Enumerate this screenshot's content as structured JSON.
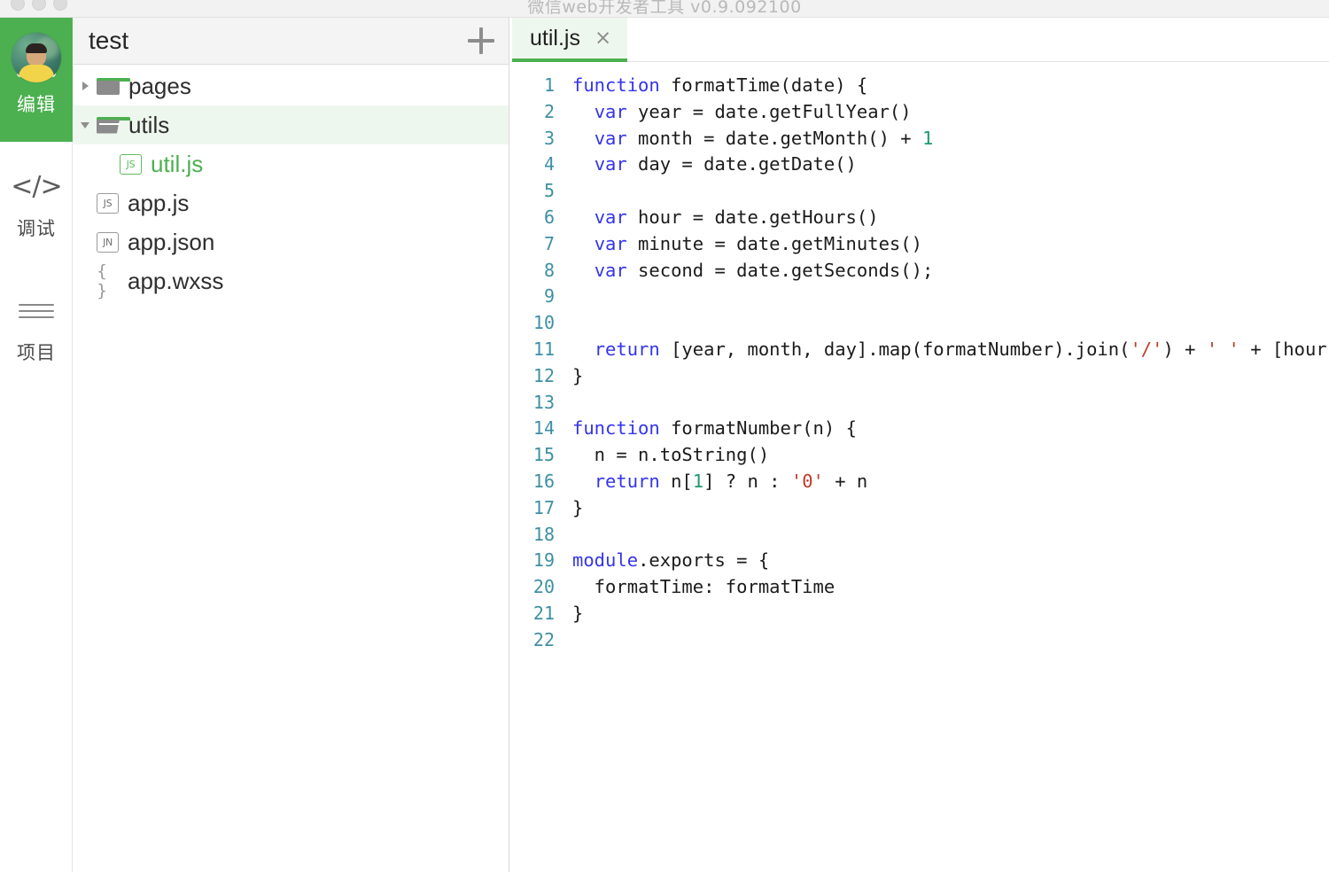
{
  "window": {
    "title": "微信web开发者工具 v0.9.092100",
    "traffic_lights": [
      "close",
      "minimize",
      "zoom"
    ]
  },
  "rail": {
    "avatar_label": "user-avatar",
    "items": [
      {
        "label": "编辑",
        "icon": "code-box-icon",
        "active": true,
        "name": "edit"
      },
      {
        "label": "调试",
        "icon": "code-brackets-icon",
        "active": false,
        "name": "debug"
      },
      {
        "label": "项目",
        "icon": "hamburger-icon",
        "active": false,
        "name": "project"
      }
    ]
  },
  "file_panel": {
    "title": "test",
    "add_button_label": "+",
    "tree": [
      {
        "label": "pages",
        "type": "folder",
        "state": "collapsed",
        "depth": 0,
        "selected": false,
        "icon": "folder-closed-icon"
      },
      {
        "label": "utils",
        "type": "folder",
        "state": "expanded",
        "depth": 0,
        "selected": true,
        "icon": "folder-open-icon"
      },
      {
        "label": "util.js",
        "type": "file",
        "badge": "JS",
        "depth": 1,
        "active": true,
        "icon": "js-file-icon"
      },
      {
        "label": "app.js",
        "type": "file",
        "badge": "JS",
        "depth": 0,
        "active": false,
        "icon": "js-file-icon"
      },
      {
        "label": "app.json",
        "type": "file",
        "badge": "JN",
        "depth": 0,
        "active": false,
        "icon": "json-file-icon"
      },
      {
        "label": "app.wxss",
        "type": "file",
        "badge": "{ }",
        "depth": 0,
        "active": false,
        "icon": "wxss-file-icon"
      }
    ]
  },
  "editor": {
    "tabs": [
      {
        "label": "util.js",
        "close": "×",
        "active": true
      }
    ],
    "total_lines": 22,
    "lines": [
      {
        "n": 1,
        "tokens": [
          {
            "t": "function",
            "c": "kw"
          },
          {
            "t": " formatTime(date) {",
            "c": ""
          }
        ]
      },
      {
        "n": 2,
        "tokens": [
          {
            "t": "  ",
            "c": ""
          },
          {
            "t": "var",
            "c": "kw"
          },
          {
            "t": " year = date.getFullYear()",
            "c": ""
          }
        ]
      },
      {
        "n": 3,
        "tokens": [
          {
            "t": "  ",
            "c": ""
          },
          {
            "t": "var",
            "c": "kw"
          },
          {
            "t": " month = date.getMonth() + ",
            "c": ""
          },
          {
            "t": "1",
            "c": "num"
          }
        ]
      },
      {
        "n": 4,
        "tokens": [
          {
            "t": "  ",
            "c": ""
          },
          {
            "t": "var",
            "c": "kw"
          },
          {
            "t": " day = date.getDate()",
            "c": ""
          }
        ]
      },
      {
        "n": 5,
        "tokens": []
      },
      {
        "n": 6,
        "tokens": [
          {
            "t": "  ",
            "c": ""
          },
          {
            "t": "var",
            "c": "kw"
          },
          {
            "t": " hour = date.getHours()",
            "c": ""
          }
        ]
      },
      {
        "n": 7,
        "tokens": [
          {
            "t": "  ",
            "c": ""
          },
          {
            "t": "var",
            "c": "kw"
          },
          {
            "t": " minute = date.getMinutes()",
            "c": ""
          }
        ]
      },
      {
        "n": 8,
        "tokens": [
          {
            "t": "  ",
            "c": ""
          },
          {
            "t": "var",
            "c": "kw"
          },
          {
            "t": " second = date.getSeconds();",
            "c": ""
          }
        ]
      },
      {
        "n": 9,
        "tokens": []
      },
      {
        "n": 10,
        "tokens": []
      },
      {
        "n": 11,
        "tokens": [
          {
            "t": "  ",
            "c": ""
          },
          {
            "t": "return",
            "c": "kw"
          },
          {
            "t": " [year, month, day].map(formatNumber).join(",
            "c": ""
          },
          {
            "t": "'/'",
            "c": "str"
          },
          {
            "t": ") + ",
            "c": ""
          },
          {
            "t": "' '",
            "c": "str"
          },
          {
            "t": " + [hour,",
            "c": ""
          }
        ]
      },
      {
        "n": 12,
        "tokens": [
          {
            "t": "}",
            "c": ""
          }
        ]
      },
      {
        "n": 13,
        "tokens": []
      },
      {
        "n": 14,
        "tokens": [
          {
            "t": "function",
            "c": "kw"
          },
          {
            "t": " formatNumber(n) {",
            "c": ""
          }
        ]
      },
      {
        "n": 15,
        "tokens": [
          {
            "t": "  n = n.toString()",
            "c": ""
          }
        ]
      },
      {
        "n": 16,
        "tokens": [
          {
            "t": "  ",
            "c": ""
          },
          {
            "t": "return",
            "c": "kw"
          },
          {
            "t": " n[",
            "c": ""
          },
          {
            "t": "1",
            "c": "num"
          },
          {
            "t": "] ? n : ",
            "c": ""
          },
          {
            "t": "'0'",
            "c": "str"
          },
          {
            "t": " + n",
            "c": ""
          }
        ]
      },
      {
        "n": 17,
        "tokens": [
          {
            "t": "}",
            "c": ""
          }
        ]
      },
      {
        "n": 18,
        "tokens": []
      },
      {
        "n": 19,
        "tokens": [
          {
            "t": "module",
            "c": "mod"
          },
          {
            "t": ".exports = {",
            "c": ""
          }
        ]
      },
      {
        "n": 20,
        "tokens": [
          {
            "t": "  formatTime: formatTime",
            "c": ""
          }
        ]
      },
      {
        "n": 21,
        "tokens": [
          {
            "t": "}",
            "c": ""
          }
        ]
      },
      {
        "n": 22,
        "tokens": []
      }
    ]
  },
  "colors": {
    "accent_green": "#4cb050",
    "selection_green": "#eef7ee",
    "keyword_blue": "#3434ec",
    "string_red": "#c0392b",
    "number_green": "#1e9a6b",
    "linenum_teal": "#3e8fa3",
    "title_grey": "#b9b9b9"
  }
}
